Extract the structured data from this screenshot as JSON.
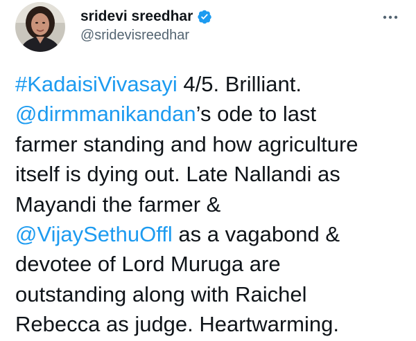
{
  "author": {
    "display_name": "sridevi sreedhar",
    "handle": "@sridevisreedhar",
    "verified_icon": "verified-badge-icon",
    "avatar_icon": "profile-photo"
  },
  "menu": {
    "more_icon": "more-options-icon"
  },
  "colors": {
    "link": "#1d9bf0",
    "text": "#0f1419",
    "secondary": "#536471"
  },
  "tweet": {
    "hashtag": "#KadaisiVivasayi",
    "line1_text": " 4/5. Brilliant.",
    "mention1": "@dirmmanikandan",
    "line2_text": "’s ode to last",
    "line3": "farmer standing and how agriculture",
    "line4": "itself is dying out. Late Nallandi as",
    "line5": "Mayandi the farmer &",
    "mention2": "@VijaySethuOffl",
    "line6_text": " as a vagabond &",
    "line7": "devotee of Lord Muruga are",
    "line8": "outstanding along with Raichel",
    "line9": "Rebecca as judge. Heartwarming."
  }
}
